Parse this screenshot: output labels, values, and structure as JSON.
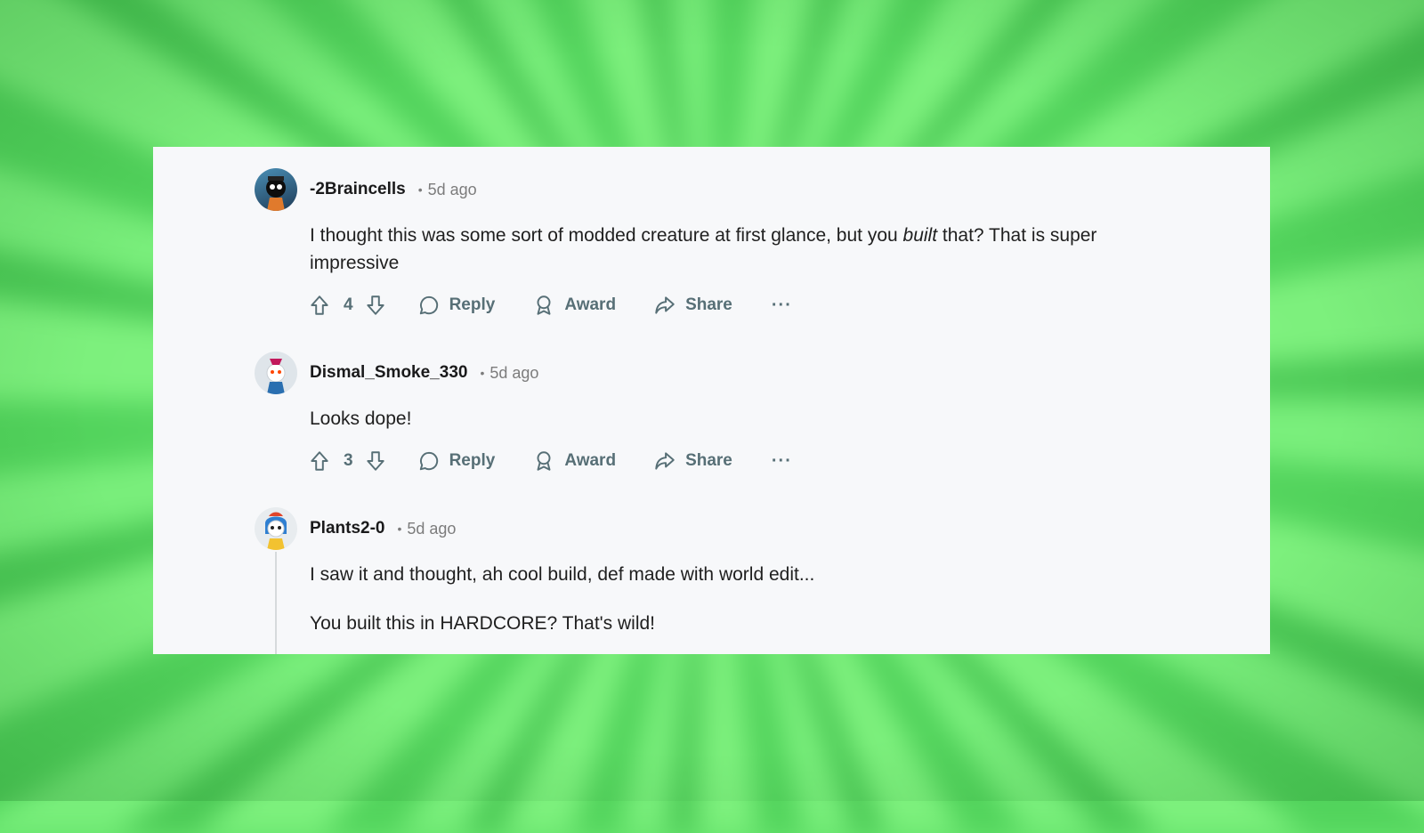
{
  "comments": [
    {
      "username": "-2Braincells",
      "time": "5d ago",
      "text_before": "I thought this was some sort of modded creature at first glance, but you ",
      "text_em": "built",
      "text_after": " that? That is super impressive",
      "votes": "4",
      "reply": "Reply",
      "award": "Award",
      "share": "Share",
      "more": "···"
    },
    {
      "username": "Dismal_Smoke_330",
      "time": "5d ago",
      "text": "Looks dope!",
      "votes": "3",
      "reply": "Reply",
      "award": "Award",
      "share": "Share",
      "more": "···"
    },
    {
      "username": "Plants2-0",
      "time": "5d ago",
      "paragraphs": [
        "I saw it and thought, ah cool build, def made with world edit...",
        "You built this in HARDCORE? That's wild!"
      ]
    }
  ],
  "separator": "•",
  "icons": [
    "upvote-icon",
    "downvote-icon",
    "reply-icon",
    "award-icon",
    "share-icon",
    "more-icon"
  ],
  "colors": {
    "background": "#63e36b",
    "panel": "#f7f8fa",
    "action_text": "#576f76",
    "meta": "#7c7c7c"
  }
}
